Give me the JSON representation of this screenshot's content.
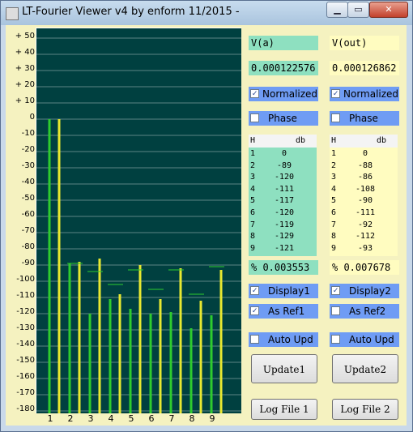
{
  "window": {
    "title": "LT-Fourier Viewer  v4  by enform 11/2015 -",
    "minimize_glyph": "▁",
    "maximize_glyph": "▭",
    "close_glyph": "✕"
  },
  "chart_data": {
    "type": "bar",
    "categories": [
      "1",
      "2",
      "3",
      "4",
      "5",
      "6",
      "7",
      "8",
      "9"
    ],
    "y_tick_labels": [
      "+ 50",
      "+ 40",
      "+ 30",
      "+ 20",
      "+ 10",
      "0",
      "-10",
      "-20",
      "-30",
      "-40",
      "-50",
      "-60",
      "-70",
      "-80",
      "-90",
      "-100",
      "-110",
      "-120",
      "-130",
      "-140",
      "-150",
      "-160",
      "-170",
      "-180"
    ],
    "ylim": [
      -180,
      50
    ],
    "grid": true,
    "series": [
      {
        "values": [
          0,
          -89,
          -120,
          -111,
          -117,
          -120,
          -119,
          -129,
          -121
        ],
        "color": "#2ecc2e"
      },
      {
        "values": [
          0,
          -88,
          -86,
          -108,
          -90,
          -111,
          -92,
          -112,
          -93
        ],
        "color": "#e8e830"
      }
    ],
    "ref_markers": [
      -89,
      -94,
      -102,
      -93,
      -105,
      -93,
      -108,
      -91
    ],
    "ref_color": "#2ecc2e"
  },
  "left": {
    "title": "V(a)",
    "value": "0.000122576",
    "normalized": "Normalized",
    "phase": "Phase",
    "table_header_h": "H",
    "table_header_db": "db",
    "rows": [
      {
        "h": "1",
        "db": "0"
      },
      {
        "h": "2",
        "db": "-89"
      },
      {
        "h": "3",
        "db": "-120"
      },
      {
        "h": "4",
        "db": "-111"
      },
      {
        "h": "5",
        "db": "-117"
      },
      {
        "h": "6",
        "db": "-120"
      },
      {
        "h": "7",
        "db": "-119"
      },
      {
        "h": "8",
        "db": "-129"
      },
      {
        "h": "9",
        "db": "-121"
      }
    ],
    "thd": "% 0.003553",
    "display": "Display1",
    "as_ref": "As Ref1",
    "auto_upd": "Auto Upd",
    "update_button": "Update1",
    "log_button": "Log File 1",
    "normalized_checked": "✓",
    "display_checked": "✓",
    "as_ref_checked": "✓"
  },
  "right": {
    "title": "V(out)",
    "value": "0.000126862",
    "normalized": "Normalized",
    "phase": "Phase",
    "table_header_h": "H",
    "table_header_db": "db",
    "rows": [
      {
        "h": "1",
        "db": "0"
      },
      {
        "h": "2",
        "db": "-88"
      },
      {
        "h": "3",
        "db": "-86"
      },
      {
        "h": "4",
        "db": "-108"
      },
      {
        "h": "5",
        "db": "-90"
      },
      {
        "h": "6",
        "db": "-111"
      },
      {
        "h": "7",
        "db": "-92"
      },
      {
        "h": "8",
        "db": "-112"
      },
      {
        "h": "9",
        "db": "-93"
      }
    ],
    "thd": "% 0.007678",
    "display": "Display2",
    "as_ref": "As Ref2",
    "auto_upd": "Auto Upd",
    "update_button": "Update2",
    "log_button": "Log File 2",
    "normalized_checked": "✓",
    "display_checked": "✓"
  }
}
